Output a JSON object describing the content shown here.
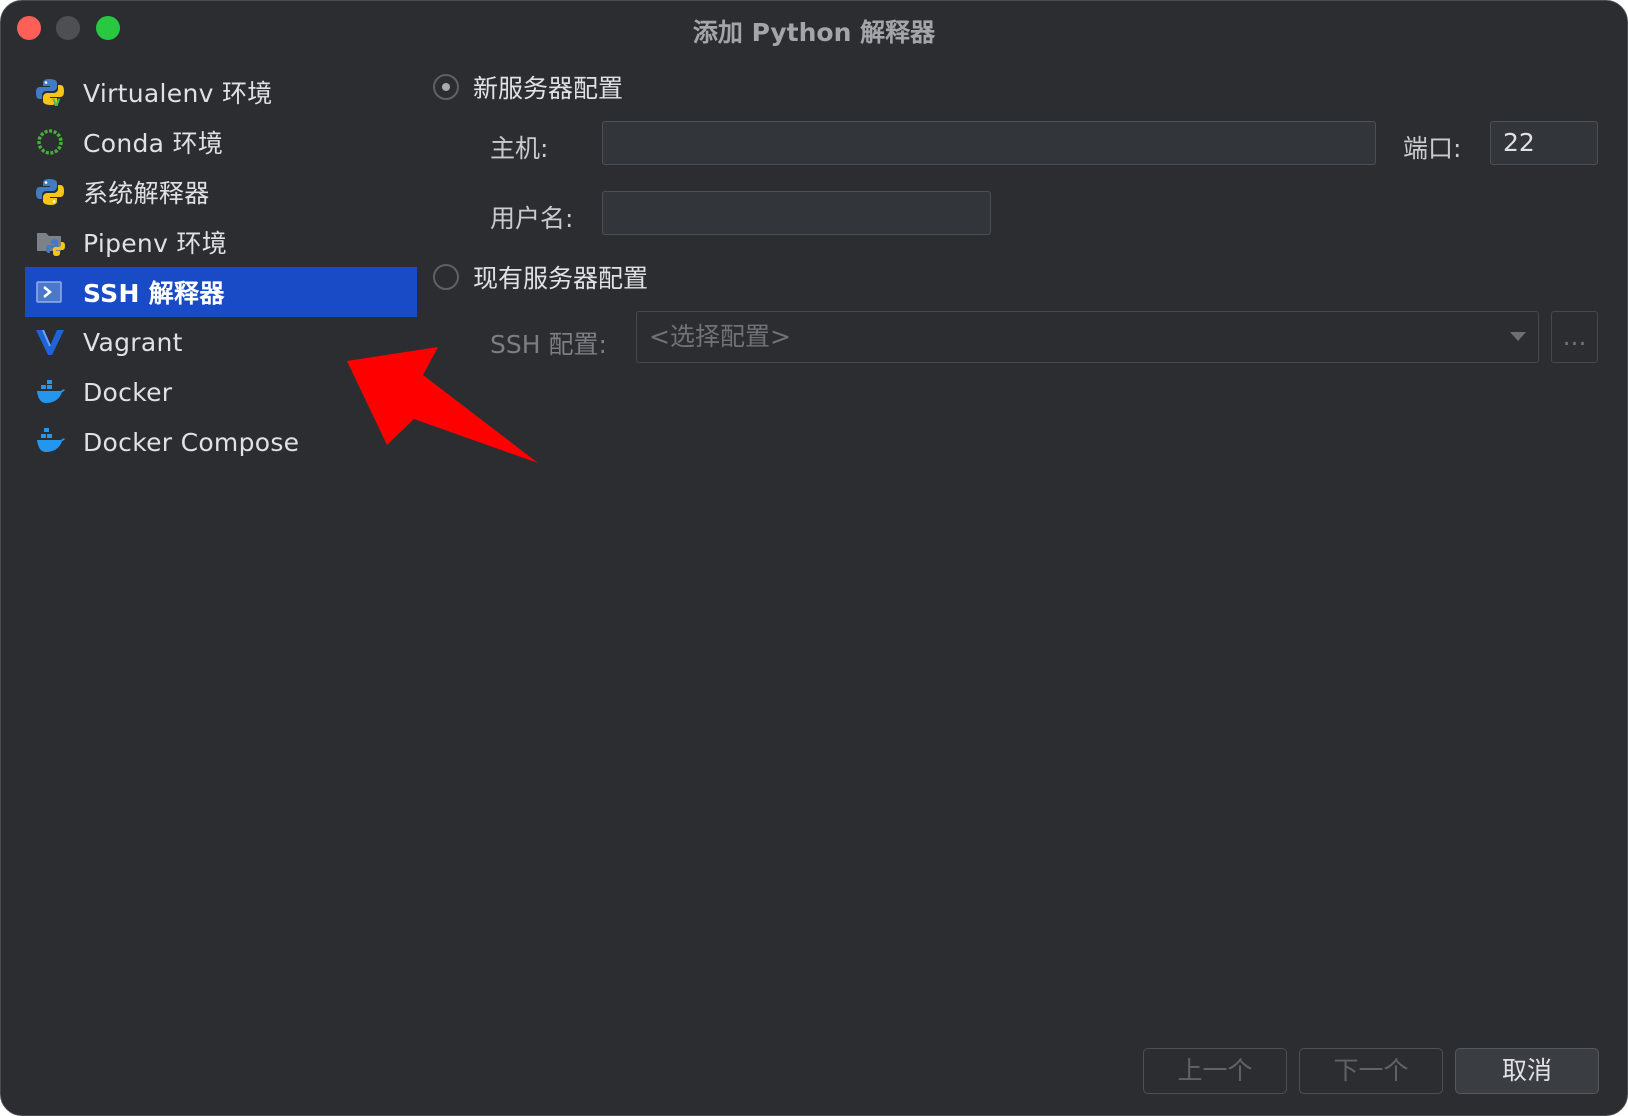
{
  "window": {
    "title": "添加 Python 解释器",
    "traffic_lights": [
      "close",
      "minimize",
      "maximize"
    ]
  },
  "sidebar": {
    "items": [
      {
        "label": "Virtualenv 环境",
        "icon": "python-virtualenv-icon"
      },
      {
        "label": "Conda 环境",
        "icon": "conda-icon"
      },
      {
        "label": "系统解释器",
        "icon": "python-icon"
      },
      {
        "label": "Pipenv 环境",
        "icon": "pipenv-icon"
      },
      {
        "label": "SSH 解释器",
        "icon": "ssh-terminal-icon",
        "selected": true
      },
      {
        "label": "Vagrant",
        "icon": "vagrant-icon"
      },
      {
        "label": "Docker",
        "icon": "docker-icon"
      },
      {
        "label": "Docker Compose",
        "icon": "docker-compose-icon"
      }
    ]
  },
  "form": {
    "new_server": {
      "label": "新服务器配置",
      "checked": true,
      "host_label": "主机:",
      "host_value": "",
      "port_label": "端口:",
      "port_value": "22",
      "username_label": "用户名:",
      "username_value": ""
    },
    "existing_server": {
      "label": "现有服务器配置",
      "checked": false,
      "ssh_config_label": "SSH 配置:",
      "ssh_config_value": "<选择配置>",
      "browse_label": "..."
    }
  },
  "footer": {
    "previous_label": "上一个",
    "next_label": "下一个",
    "cancel_label": "取消"
  },
  "colors": {
    "background": "#2b2d30",
    "selection": "#1a4bc6",
    "annotation_arrow": "#ff0000"
  }
}
